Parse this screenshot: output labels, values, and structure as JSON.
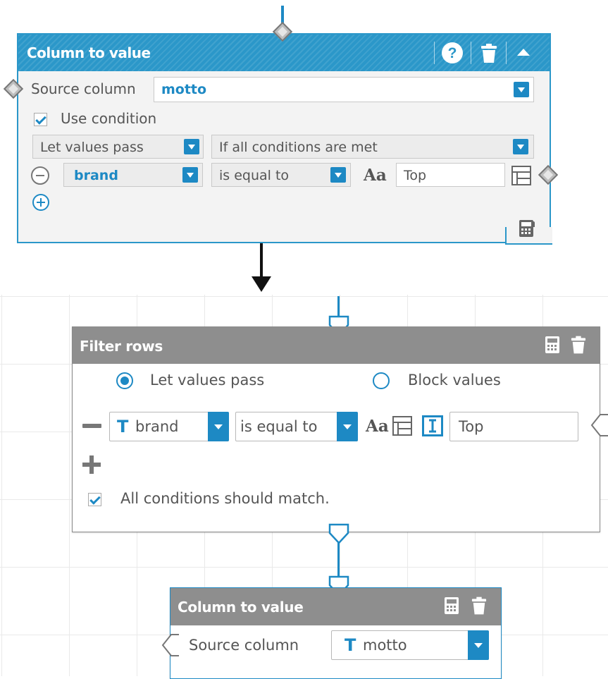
{
  "top_node": {
    "title": "Column to value",
    "source_label": "Source column",
    "source_value": "motto",
    "use_condition_label": "Use condition",
    "use_condition_checked": true,
    "mode_value": "Let values pass",
    "match_value": "If all conditions are met",
    "condition": {
      "column": "brand",
      "operator": "is equal to",
      "case_icon": "Aa",
      "value": "Top"
    }
  },
  "filter_node": {
    "title": "Filter rows",
    "radio_pass_label": "Let values pass",
    "radio_block_label": "Block values",
    "selected": "pass",
    "condition": {
      "type_icon": "T",
      "column": "brand",
      "operator": "is equal to",
      "case_icon": "Aa",
      "value": "Top"
    },
    "all_match_label": "All conditions should match.",
    "all_match_checked": true
  },
  "bottom_node": {
    "title": "Column to value",
    "source_label": "Source column",
    "type_icon": "T",
    "source_value": "motto"
  },
  "colors": {
    "accent": "#1d89c4",
    "header_blue": "#2b97c9",
    "header_grey": "#8e8e8e"
  }
}
